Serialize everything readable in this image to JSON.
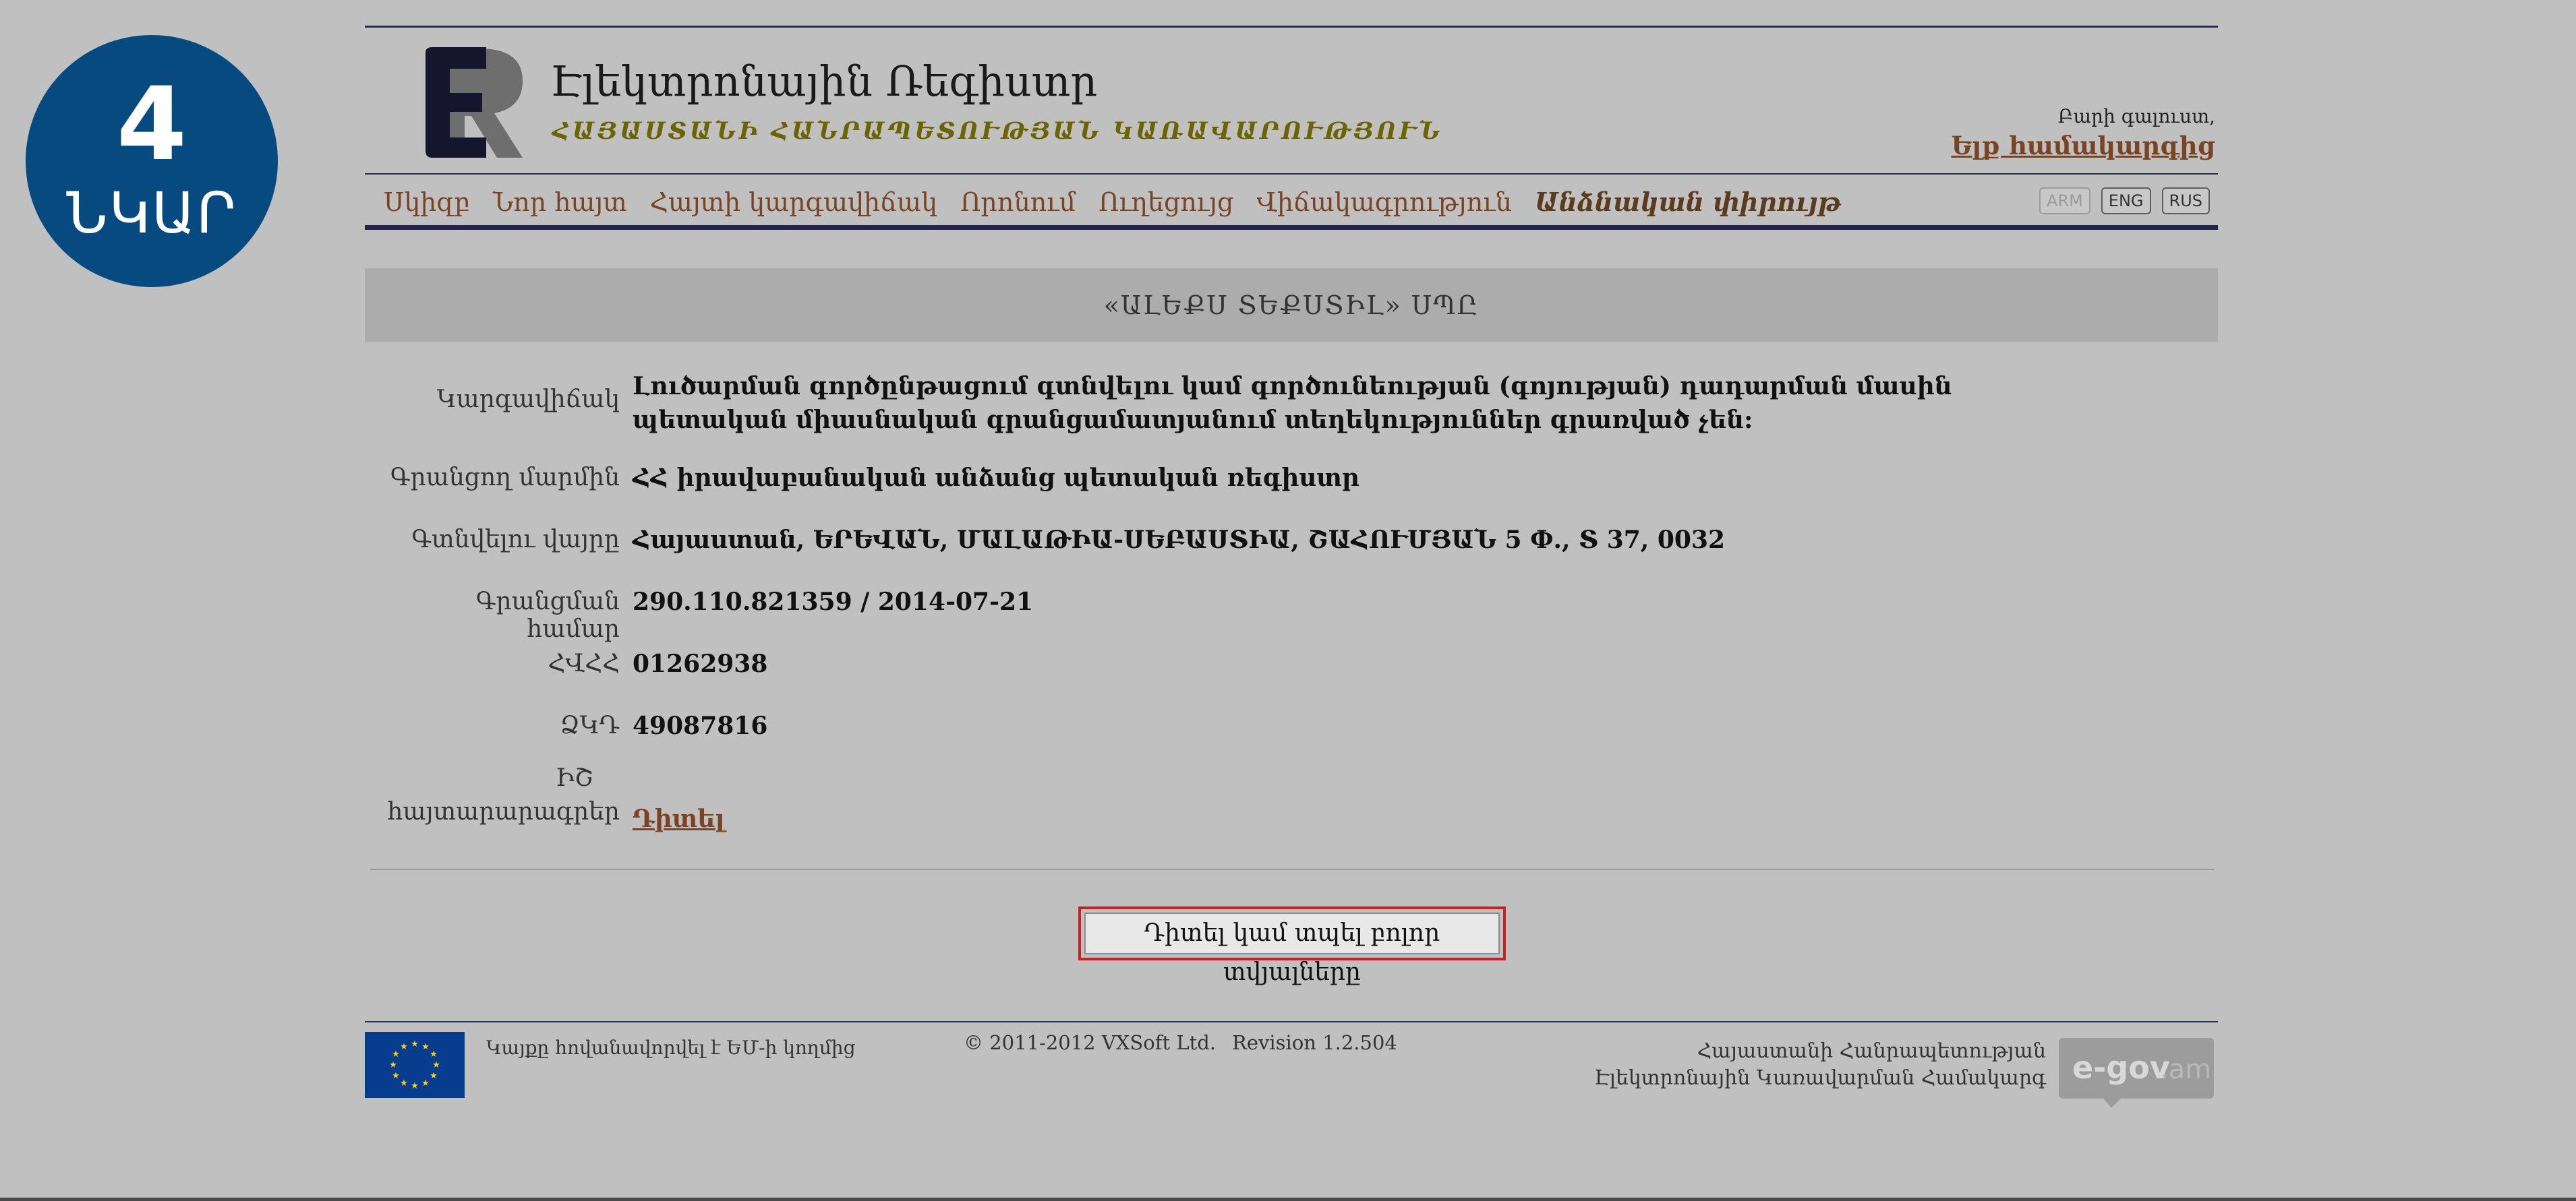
{
  "badge": {
    "number": "4",
    "word": "ՆԿԱՐ"
  },
  "header": {
    "logo_letters": "ER",
    "title": "Էլեկտրոնային Ռեգիստր",
    "subtitle": "ՀԱՅԱՍՏԱՆԻ ՀԱՆՐԱՊԵՏՈՒԹՅԱՆ ԿԱՌԱՎԱՐՈՒԹՅՈՒՆ",
    "greeting": "Բարի գալուստ,",
    "login": "Ելք համակարգից"
  },
  "nav": {
    "items": [
      "Սկիզբ",
      "Նոր հայտ",
      "Հայտի կարգավիճակ",
      "Որոնում",
      "Ուղեցույց",
      "Վիճակագրություն",
      "Անձնական փիրույթ"
    ],
    "languages": [
      "ARM",
      "ENG",
      "RUS"
    ]
  },
  "company": {
    "name": "«ԱԼԵՔՍ ՏԵՔՍՏԻԼ» ՍՊԸ"
  },
  "details": {
    "status_label": "Կարգավիճակ",
    "status_value": "Լուծարման գործընթացում գտնվելու կամ գործունեության (գոյության) դադարման մասին պետական միասնական գրանցամատյանում տեղեկություններ գրառված չեն:",
    "registrar_label": "Գրանցող մարմին",
    "registrar_value": "ՀՀ իրավաբանական անձանց պետական ռեգիստր",
    "address_label": "Գտնվելու վայրը",
    "address_value": "Հայաստան, ԵՐԵՎԱՆ, ՄԱԼԱԹԻԱ-ՍԵԲԱՍՏԻԱ, ՇԱՀՈՒՄՅԱՆ 5 Փ., Տ 37, 0032",
    "regnum_label": "Գրանցման համար",
    "regnum_value": "290.110.821359 / 2014-07-21",
    "tin_label": "ՀՎՀՀ",
    "tin_value": "01262938",
    "zkd_label": "ՁԿԴ",
    "zkd_value": "49087816",
    "declarations_label_1": "ԻՇ",
    "declarations_label_2": "հայտարարագրեր",
    "declarations_link": "Դիտել"
  },
  "actions": {
    "view_all": "Դիտել կամ տպել բոլոր տվյալները"
  },
  "footer": {
    "eu_text": "Կայքը հովանավորվել է ԵՄ-ի կողմից",
    "copyright": "© 2011-2012 VXSoft Ltd.",
    "revision": "Revision 1.2.504",
    "gov_line1": "Հայաստանի Հանրապետության",
    "gov_line2": "Էլեկտրոնային Կառավարման Համակարգ",
    "egov_main": "e-gov",
    "egov_suffix": ".am"
  },
  "colors": {
    "badge": "#064a80",
    "link": "#7a4424",
    "highlight": "#d01f1f",
    "background": "#c0c0c0"
  }
}
